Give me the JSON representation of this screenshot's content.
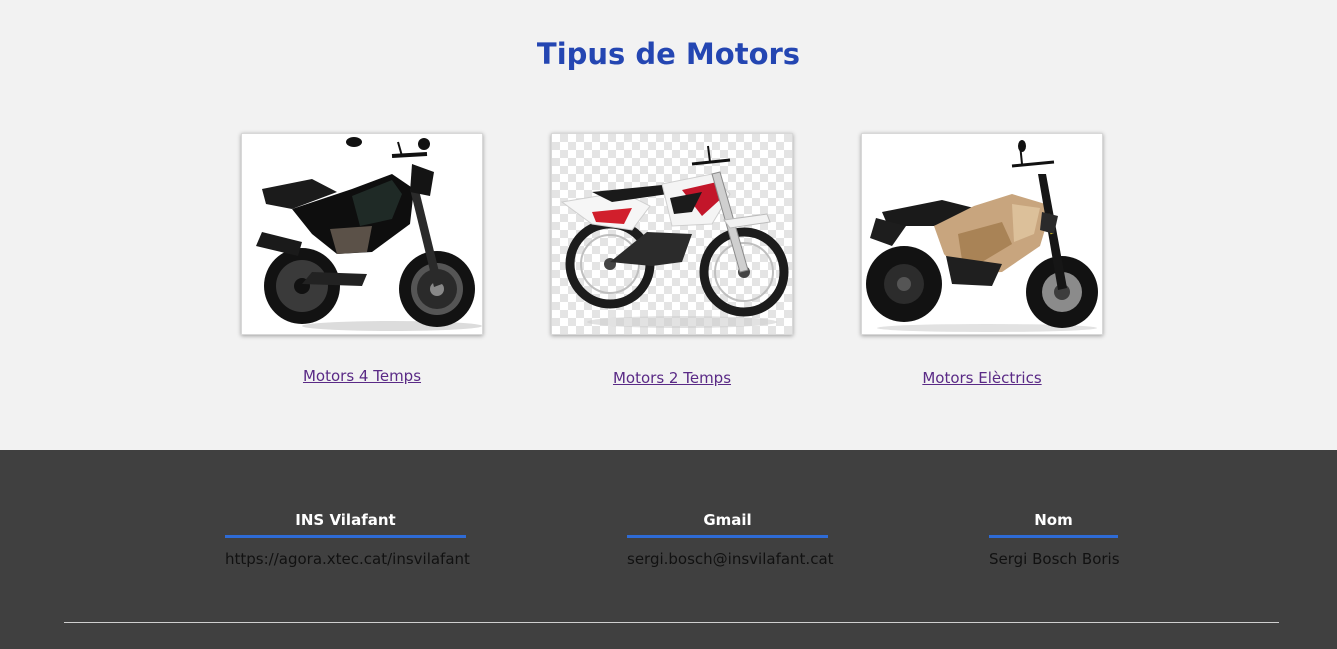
{
  "page": {
    "title": "Tipus de Motors"
  },
  "cards": [
    {
      "label": "Motors 4 Temps",
      "icon": "motorcycle-icon"
    },
    {
      "label": "Motors 2 Temps",
      "icon": "dirt-bike-icon"
    },
    {
      "label": "Motors Elèctrics",
      "icon": "electric-motorcycle-icon"
    }
  ],
  "footer": {
    "columns": [
      {
        "heading": "INS Vilafant",
        "value": "https://agora.xtec.cat/insvilafant"
      },
      {
        "heading": "Gmail",
        "value": "sergi.bosch@insvilafant.cat"
      },
      {
        "heading": "Nom",
        "value": "Sergi Bosch Boris"
      }
    ]
  },
  "colors": {
    "title": "#2446b2",
    "link": "#5a2a86",
    "footer_bg": "#404040",
    "accent_underline": "#2e6bd6",
    "page_bg": "#f2f2f2"
  }
}
